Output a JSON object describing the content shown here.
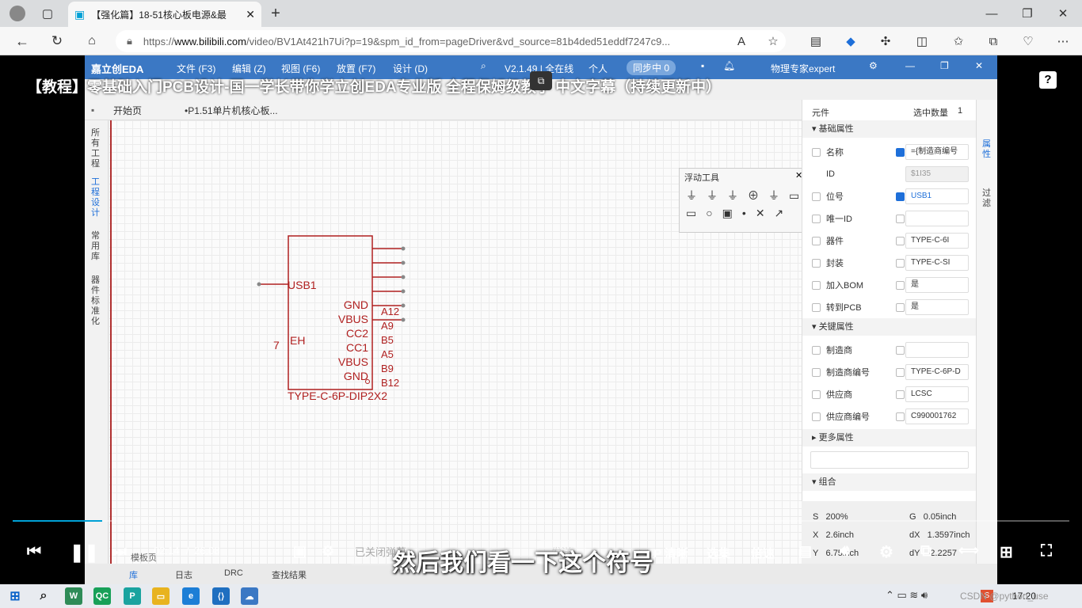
{
  "browser": {
    "tab_title": "【强化篇】18-51核心板电源&最",
    "url_prefix": "https://",
    "url_domain": "www.bilibili.com",
    "url_path": "/video/BV1At421h7Ui?p=19&spm_id_from=pageDriver&vd_source=81b4ded51eddf7247c9..."
  },
  "video": {
    "title": "【教程】零基础入门PCB设计-国一学长带你学立创EDA专业版 全程保姆级教学 中文字幕（持续更新中）",
    "time_current": "02:14",
    "time_sep": "/",
    "time_total": "26:08",
    "progress": 0.085,
    "danmu_placeholder": "已关闭弹幕",
    "send_label": "发送",
    "quality_label": "480P 清晰",
    "episodes_label": "选集",
    "speed_label": "倍速",
    "subtitle": "然后我们看一下这个符号",
    "help_label": "?"
  },
  "eda": {
    "brand": "嘉立创EDA",
    "menu": [
      "文件 (F3)",
      "编辑 (Z)",
      "视图 (F6)",
      "放置 (F7)",
      "设计 (D)"
    ],
    "version": "V2.1.49 | 全在线",
    "user_mode": "个人",
    "sync": "同步中 0",
    "username": "物理专家expert",
    "tabs": [
      "开始页",
      "•P1.51单片机核心板..."
    ],
    "left_nav": [
      "所有工程",
      "工程设计",
      "常用库",
      "器件标准化"
    ],
    "float_tool_title": "浮动工具",
    "right_strip": [
      "属性",
      "过滤"
    ],
    "component": {
      "designator": "USB1",
      "value": "TYPE-C-6P-DIP2X2",
      "left_pin_name": "EH",
      "left_pin_number": "7",
      "pins": [
        {
          "name": "GND",
          "number": "A12"
        },
        {
          "name": "VBUS",
          "number": "A9"
        },
        {
          "name": "CC2",
          "number": "B5"
        },
        {
          "name": "CC1",
          "number": "A5"
        },
        {
          "name": "VBUS",
          "number": "B9"
        },
        {
          "name": "GND",
          "number": "B12"
        }
      ]
    },
    "props": {
      "header_label": "元件",
      "selected_label": "选中数量",
      "selected_count": "1",
      "basic_section": "基础属性",
      "basic": [
        {
          "label": "名称",
          "checked": true,
          "value": "={制造商编号"
        },
        {
          "label": "ID",
          "checked": false,
          "value": "$1I35"
        },
        {
          "label": "位号",
          "checked": true,
          "value": "USB1"
        },
        {
          "label": "唯一ID",
          "checked": false,
          "value": ""
        },
        {
          "label": "器件",
          "checked": false,
          "value": "TYPE-C-6I"
        },
        {
          "label": "封装",
          "checked": false,
          "value": "TYPE-C-SI"
        },
        {
          "label": "加入BOM",
          "checked": false,
          "value": "是"
        },
        {
          "label": "转到PCB",
          "checked": false,
          "value": "是"
        }
      ],
      "key_section": "关键属性",
      "key": [
        {
          "label": "制造商",
          "value": ""
        },
        {
          "label": "制造商编号",
          "value": "TYPE-C-6P-D"
        },
        {
          "label": "供应商",
          "value": "LCSC"
        },
        {
          "label": "供应商编号",
          "value": "C990001762"
        }
      ],
      "more_section": "更多属性",
      "group_section": "组合"
    },
    "coords": [
      {
        "k": "S",
        "v": "200%",
        "k2": "G",
        "v2": "0.05inch"
      },
      {
        "k": "X",
        "v": "2.6inch",
        "k2": "dX",
        "v2": "1.3597inch"
      },
      {
        "k": "Y",
        "v": "6.75inch",
        "k2": "dY",
        "v2": "-2.2257"
      }
    ],
    "bottom_tabs": [
      "库",
      "日志",
      "DRC",
      "查找结果"
    ],
    "panel_label": "模板页"
  },
  "taskbar": {
    "time": "17:20",
    "watermark": "CSDN @python_use"
  }
}
